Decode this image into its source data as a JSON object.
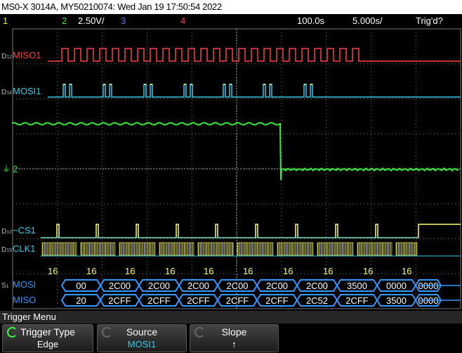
{
  "header": {
    "title": "MS0-X 3014A, MY50210074: Wed Jan 19 17:50:54 2022"
  },
  "status": {
    "ch1_num": "1",
    "ch2_num": "2",
    "ch2_scale": "2.50V/",
    "ch3_num": "3",
    "ch4_num": "4",
    "time_scale": "100.0s",
    "delay": "5.000s/",
    "trigger_status": "Trig'd?"
  },
  "channels": {
    "miso_label": "MISO1",
    "mosi_label": "MOSI1",
    "ch2_label": "2",
    "cs_label": "~CS1",
    "clk_label": "CLK1",
    "d12_prefix": "D",
    "d12_sub": "12",
    "d14_prefix": "D",
    "d14_sub": "14",
    "d13_prefix": "D",
    "d13_sub": "13",
    "d15_prefix": "D",
    "d15_sub": "15",
    "s1_prefix": "S",
    "s1_sub": "1"
  },
  "decode": {
    "counts": [
      "16",
      "16",
      "16",
      "16",
      "16",
      "16",
      "16",
      "16",
      "16",
      "16"
    ],
    "mosi_row_label": "MOSI",
    "miso_row_label": "MISO",
    "mosi_values": [
      "2C00",
      "2C00",
      "2C00",
      "2C00",
      "2C00",
      "2C00",
      "2C00",
      "3500",
      "0000",
      "0000"
    ],
    "miso_values": [
      "2CFF",
      "2CFF",
      "2CFF",
      "2CFF",
      "2CFF",
      "2CFF",
      "2C52",
      "2CFF",
      "3500",
      "0000"
    ],
    "mosi_first_visible": "00",
    "miso_first_visible": "20"
  },
  "colors": {
    "ch1": "#f0f000",
    "ch2": "#33ee33",
    "ch3": "#6f6fff",
    "ch4": "#ff3366",
    "miso": "#ff4040",
    "mosi": "#33ccee",
    "cs": "#ffff66",
    "clk": "#ffff66",
    "bus": "#3399ff",
    "grid": "#7a7a7a"
  },
  "menu": {
    "title": "Trigger Menu",
    "softkeys": [
      {
        "label": "Trigger Type",
        "value": "Edge",
        "value_color": "#ffffff",
        "active": true
      },
      {
        "label": "Source",
        "value": "MOSI1",
        "value_color": "#33ccee",
        "active": false
      },
      {
        "label": "Slope",
        "value": "↑",
        "value_color": "#ffffff",
        "active": false
      }
    ]
  }
}
